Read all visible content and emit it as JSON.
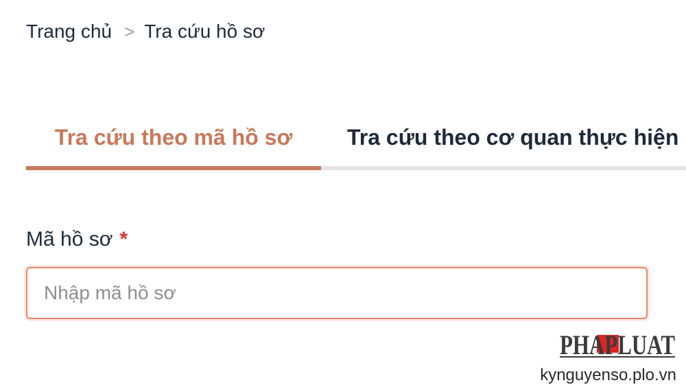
{
  "breadcrumb": {
    "home": "Trang chủ",
    "separator": ">",
    "current": "Tra cứu hồ sơ"
  },
  "tabs": [
    {
      "label": "Tra cứu theo mã hồ sơ",
      "active": true
    },
    {
      "label": "Tra cứu theo cơ quan thực hiện",
      "active": false
    }
  ],
  "form": {
    "field_label": "Mã hồ sơ",
    "required_mark": "*",
    "placeholder": "Nhập mã hồ sơ",
    "value": ""
  },
  "watermark": {
    "logo_text": "PHAPLUAT",
    "site": "kynguyenso.plo.vn"
  },
  "colors": {
    "accent": "#c8795a",
    "text": "#1d2a3a",
    "required": "#d9342b",
    "input_border": "#e8866b",
    "tab_track": "#e4e4e6"
  }
}
